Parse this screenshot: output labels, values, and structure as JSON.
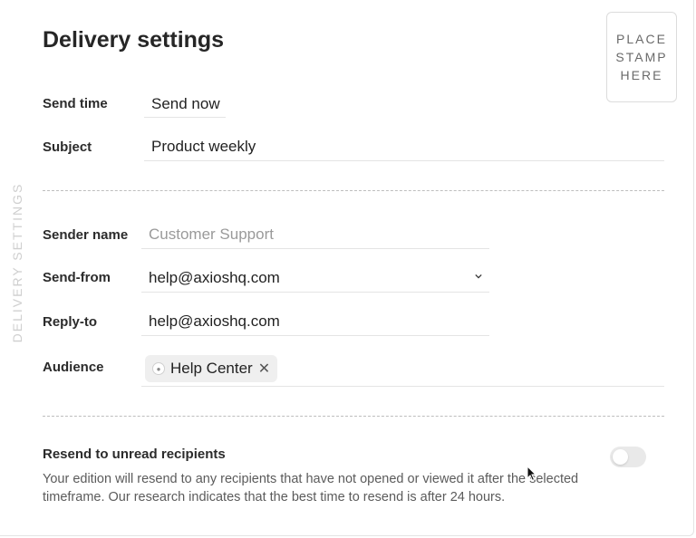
{
  "side_label": "DELIVERY SETTINGS",
  "title": "Delivery settings",
  "stamp": "PLACE\nSTAMP\nHERE",
  "fields": {
    "send_time": {
      "label": "Send time",
      "value": "Send now"
    },
    "subject": {
      "label": "Subject",
      "value": "Product weekly"
    },
    "sender_name": {
      "label": "Sender name",
      "placeholder": "Customer Support"
    },
    "send_from": {
      "label": "Send-from",
      "value": "help@axioshq.com"
    },
    "reply_to": {
      "label": "Reply-to",
      "value": "help@axioshq.com"
    },
    "audience": {
      "label": "Audience",
      "chips": [
        {
          "label": "Help Center",
          "icon": "group-icon"
        }
      ]
    }
  },
  "resend": {
    "title": "Resend to unread recipients",
    "description": "Your edition will resend to any recipients that have not opened or viewed it after the selected timeframe. Our research indicates that the best time to resend is after 24 hours.",
    "enabled": false
  },
  "colors": {
    "toggle_off": "#e9e9e9",
    "divider": "#bdbdbd",
    "chip_bg": "#efefef"
  }
}
